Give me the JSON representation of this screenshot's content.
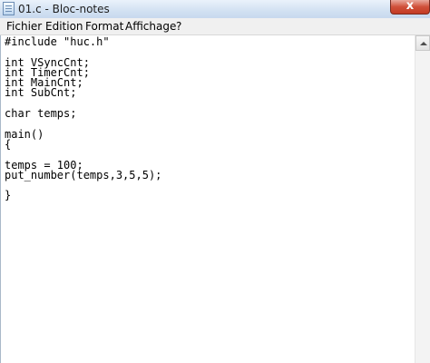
{
  "window": {
    "title": "01.c - Bloc-notes",
    "close_glyph": "x"
  },
  "menu": {
    "items": [
      "Fichier",
      "Edition",
      "Format",
      "Affichage",
      "?"
    ]
  },
  "editor": {
    "text": "#include \"huc.h\"\n\nint VSyncCnt;\nint TimerCnt;\nint MainCnt;\nint SubCnt;\n\nchar temps;\n\nmain()\n{\n\ntemps = 100;\nput_number(temps,3,5,5);\n\n}"
  },
  "icons": {
    "app": "notepad-icon",
    "close": "close-icon",
    "scroll_up": "scroll-up-arrow-icon"
  }
}
